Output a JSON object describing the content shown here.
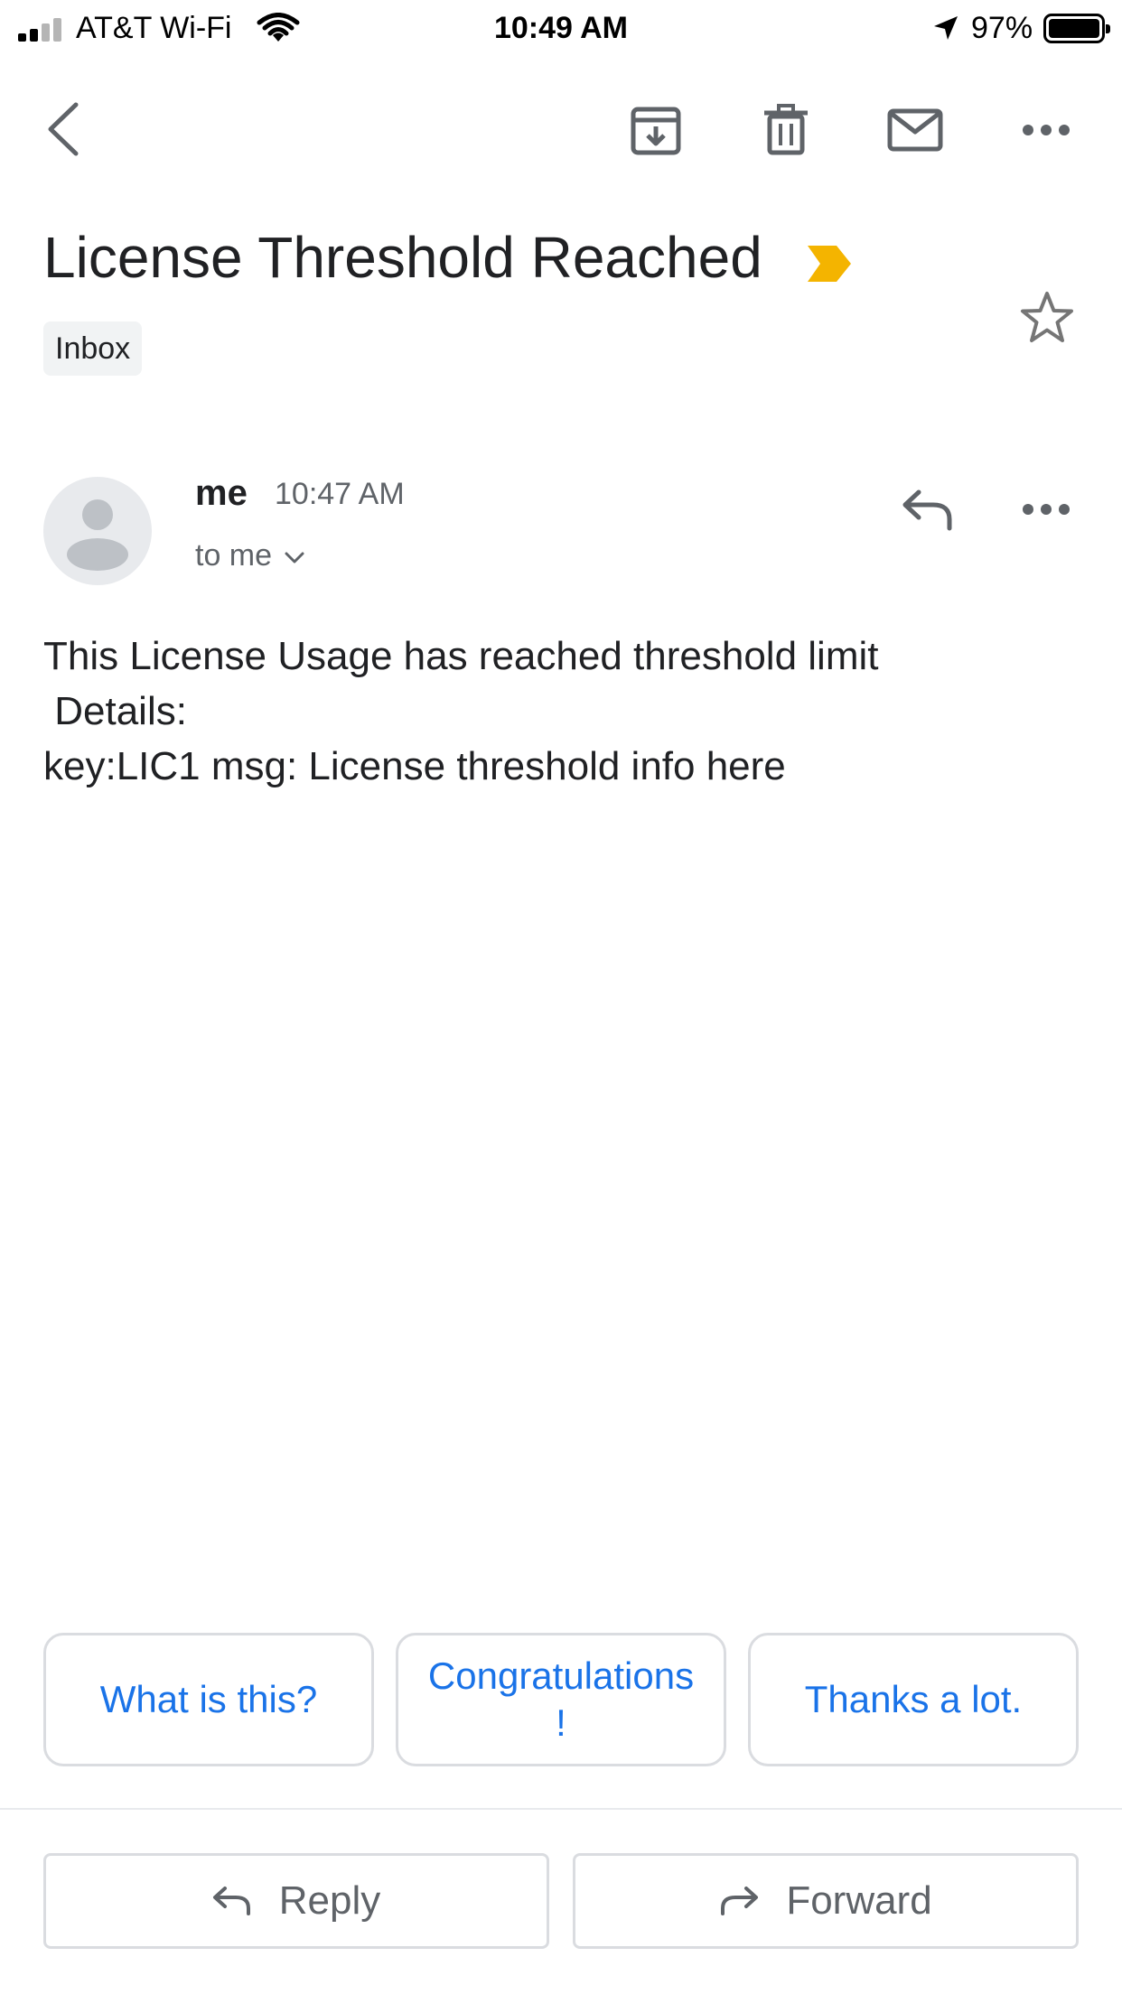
{
  "status_bar": {
    "carrier": "AT&T Wi-Fi",
    "time": "10:49 AM",
    "battery": "97%",
    "icons": [
      "signal-icon",
      "wifi-icon",
      "location-icon",
      "battery-icon"
    ]
  },
  "toolbar": {
    "icons": [
      "back-icon",
      "archive-icon",
      "delete-icon",
      "mark-unread-icon",
      "more-icon"
    ]
  },
  "email": {
    "subject": "License Threshold Reached",
    "label": "Inbox",
    "sender": "me",
    "time": "10:47 AM",
    "recipient": "to me",
    "body": "This License Usage has reached threshold limit\n Details:\nkey:LIC1 msg: License threshold info here"
  },
  "smart_replies": [
    "What is this?",
    "Congratulations\n!",
    "Thanks a lot."
  ],
  "actions": {
    "reply": "Reply",
    "forward": "Forward"
  },
  "colors": {
    "accent": "#1a73e8",
    "important": "#f4b400",
    "text": "#202124",
    "secondary_text": "#5f6368"
  }
}
